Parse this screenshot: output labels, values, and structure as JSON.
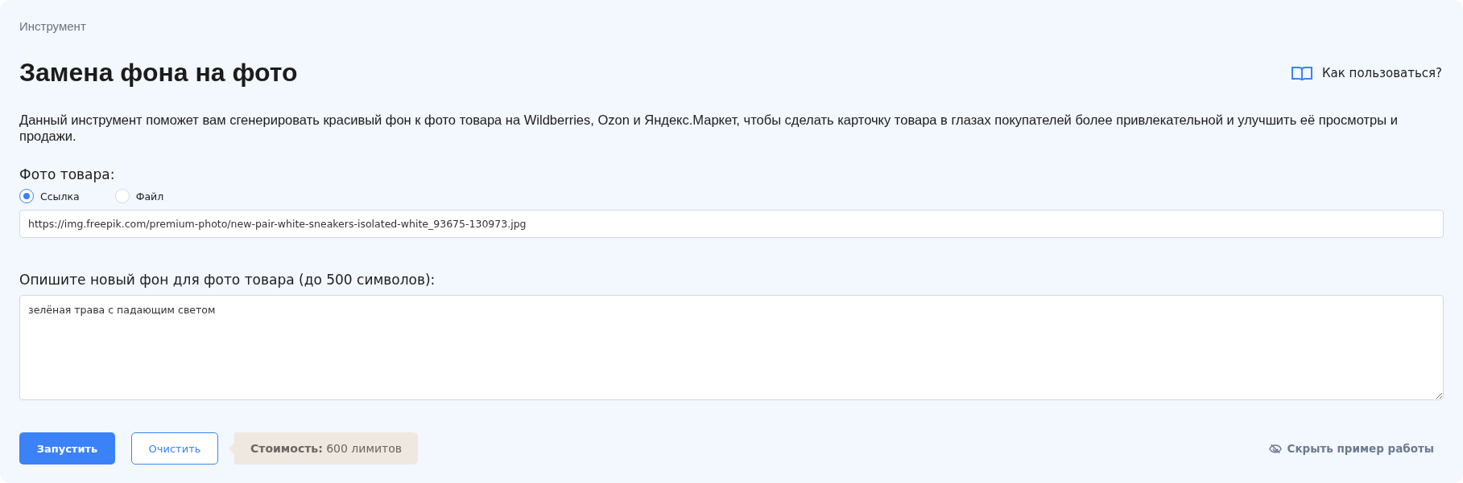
{
  "breadcrumb": "Инструмент",
  "title": "Замена фона на фото",
  "help_link": "Как пользоваться?",
  "description": "Данный инструмент поможет вам сгенерировать красивый фон к фото товара на Wildberries, Ozon и Яндекс.Маркет, чтобы сделать карточку товара в глазах покупателей более привлекательной и улучшить её просмотры и продажи.",
  "photo": {
    "label": "Фото товара:",
    "options": [
      {
        "label": "Ссылка",
        "selected": true
      },
      {
        "label": "Файл",
        "selected": false
      }
    ],
    "value": "https://img.freepik.com/premium-photo/new-pair-white-sneakers-isolated-white_93675-130973.jpg"
  },
  "background": {
    "label": "Опишите новый фон для фото товара (до 500 символов):",
    "value": "зелёная трава с падающим светом"
  },
  "buttons": {
    "run": "Запустить",
    "clear": "Очистить"
  },
  "cost": {
    "label": "Стоимость:",
    "value": "600 лимитов"
  },
  "hide_example": "Скрыть пример работы"
}
